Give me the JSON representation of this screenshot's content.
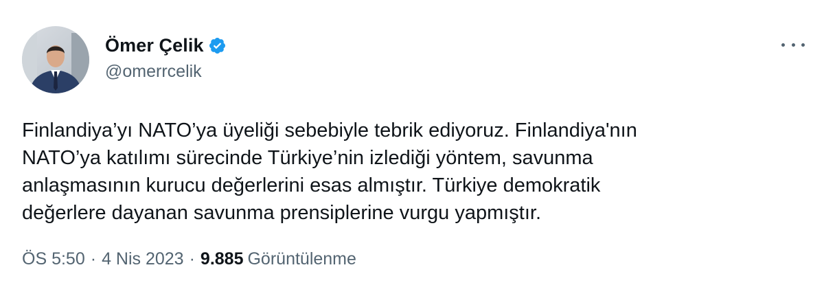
{
  "author": {
    "display_name": "Ömer Çelik",
    "handle": "@omerrcelik",
    "verified": true
  },
  "tweet": {
    "lines": [
      "Finlandiya’yı NATO’ya üyeliği sebebiyle tebrik ediyoruz. Finlandiya'nın",
      "NATO’ya katılımı sürecinde Türkiye’nin izlediği yöntem, savunma",
      "anlaşmasının kurucu değerlerini esas almıştır. Türkiye demokratik",
      "değerlere dayanan savunma prensiplerine vurgu yapmıştır."
    ]
  },
  "meta": {
    "time": "ÖS 5:50",
    "separator": "·",
    "date": "4 Nis 2023",
    "views_count": "9.885",
    "views_label": "Görüntülenme"
  },
  "colors": {
    "text_primary": "#0f1419",
    "text_secondary": "#536471",
    "verified_badge": "#1d9bf0"
  },
  "icons": {
    "verified": "verified-badge-icon",
    "more": "more-options-icon"
  }
}
